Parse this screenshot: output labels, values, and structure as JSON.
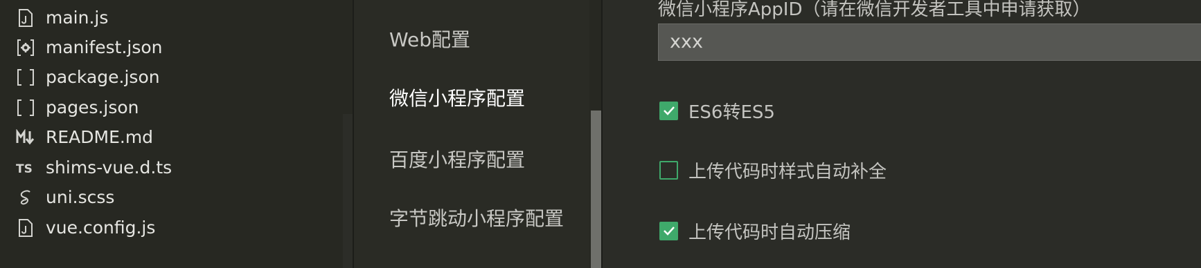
{
  "file_tree": {
    "items": [
      {
        "name": "main.js",
        "icon": "js-file-icon"
      },
      {
        "name": "manifest.json",
        "icon": "manifest-gear-icon"
      },
      {
        "name": "package.json",
        "icon": "json-brackets-icon"
      },
      {
        "name": "pages.json",
        "icon": "json-brackets-icon"
      },
      {
        "name": "README.md",
        "icon": "markdown-icon"
      },
      {
        "name": "shims-vue.d.ts",
        "icon": "typescript-icon"
      },
      {
        "name": "uni.scss",
        "icon": "sass-icon"
      },
      {
        "name": "vue.config.js",
        "icon": "js-file-icon"
      }
    ]
  },
  "settings_nav": {
    "items": [
      {
        "label": "Web配置"
      },
      {
        "label": "微信小程序配置",
        "active": true
      },
      {
        "label": "百度小程序配置"
      },
      {
        "label": "字节跳动小程序配置"
      }
    ]
  },
  "panel": {
    "appid_label": "微信小程序AppID（请在微信开发者工具中申请获取）",
    "appid_value": "xxx",
    "options": [
      {
        "label": "ES6转ES5",
        "checked": true
      },
      {
        "label": "上传代码时样式自动补全",
        "checked": false
      },
      {
        "label": "上传代码时自动压缩",
        "checked": true
      }
    ]
  },
  "colors": {
    "accent_green": "#3fa96b",
    "background": "#272822"
  }
}
